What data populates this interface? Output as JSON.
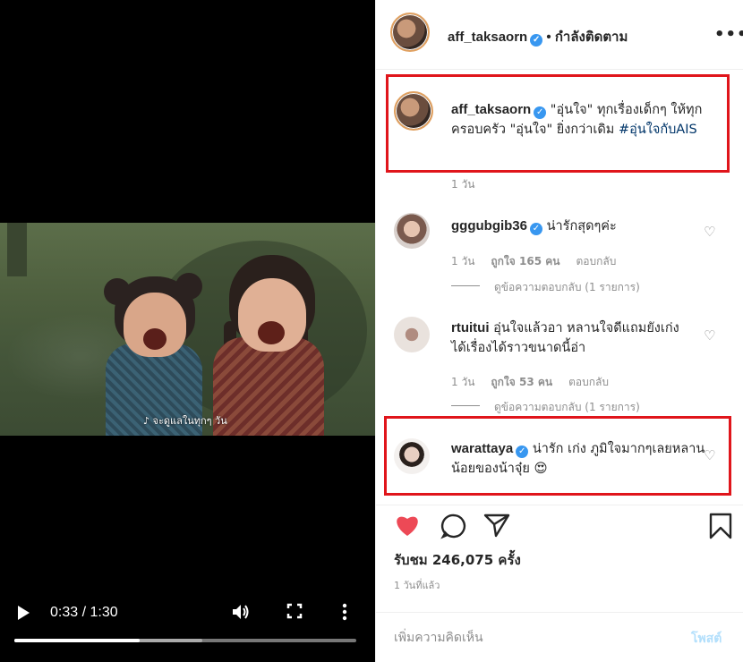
{
  "video": {
    "subtitle": "♪ จะดูแลในทุกๆ วัน",
    "time": "0:33 / 1:30",
    "progress": 0.3667,
    "buffered": 0.55,
    "play_icon": "play-icon",
    "volume_icon": "volume-icon",
    "fullscreen_icon": "fullscreen-icon",
    "more_icon": "more-vertical-icon"
  },
  "header": {
    "username": "aff_taksaorn",
    "dot": "•",
    "follow_status": "กำลังติดตาม",
    "more": "•••"
  },
  "caption": {
    "username": "aff_taksaorn",
    "text": " \"อุ่นใจ\" ทุกเรื่องเด็กๆ ให้ทุกครอบครัว \"อุ่นใจ\" ยิ่งกว่าเดิม ",
    "hashtag": "#อุ่นใจกับAIS",
    "time": "1 วัน"
  },
  "comments": [
    {
      "username": "gggubgib36",
      "text": " น่ารักสุดๆค่ะ",
      "time": "1 วัน",
      "likes": "ถูกใจ 165 คน",
      "reply": "ตอบกลับ",
      "view_replies": "ดูข้อความตอบกลับ (1 รายการ)"
    },
    {
      "username": "rtuitui",
      "text": " อุ่นใจแล้วอา หลานใจดีแถมยังเก่ง ได้เรื่องได้ราวขนาดนี้อ่า",
      "time": "1 วัน",
      "likes": "ถูกใจ 53 คน",
      "reply": "ตอบกลับ",
      "view_replies": "ดูข้อความตอบกลับ (1 รายการ)"
    },
    {
      "username": "warattaya",
      "text": " น่ารัก เก่ง ภูมิใจมากๆเลยหลานน้อยของน้าจุ๋ย 😍"
    }
  ],
  "footer": {
    "views": "รับชม 246,075 ครั้ง",
    "posted": "1 วันที่แล้ว",
    "comment_placeholder": "เพิ่มความคิดเห็น",
    "post_label": "โพสต์"
  },
  "colors": {
    "highlight": "#e0151b",
    "like_active": "#ed4956",
    "link": "#003569",
    "verified": "#3897f0"
  }
}
